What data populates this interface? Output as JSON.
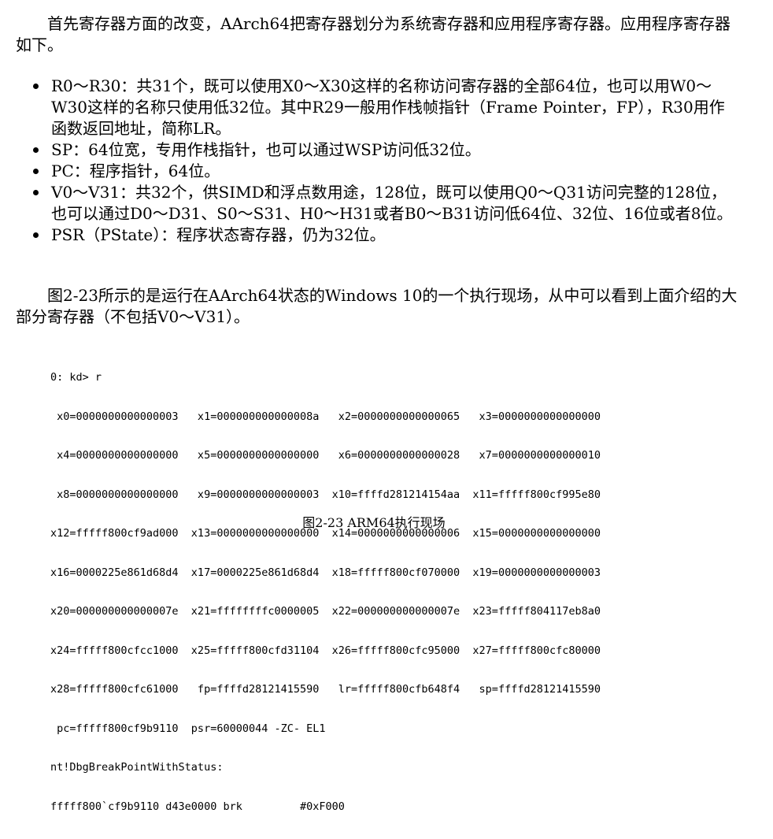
{
  "paragraphs": {
    "intro": "首先寄存器方面的改变，AArch64把寄存器划分为系统寄存器和应用程序寄存器。应用程序寄存器如下。",
    "figure_intro": "图2-23所示的是运行在AArch64状态的Windows 10的一个执行现场，从中可以看到上面介绍的大部分寄存器（不包括V0～V31）。"
  },
  "bullets": [
    "R0～R30：共31个，既可以使用X0～X30这样的名称访问寄存器的全部64位，也可以用W0～W30这样的名称只使用低32位。其中R29一般用作栈帧指针（Frame Pointer，FP），R30用作函数返回地址，简称LR。",
    "SP：64位宽，专用作栈指针，也可以通过WSP访问低32位。",
    "PC：程序指针，64位。",
    "V0～V31：共32个，供SIMD和浮点数用途，128位，既可以使用Q0～Q31访问完整的128位，也可以通过D0～D31、S0～S31、H0～H31或者B0～B31访问低64位、32位、16位或者8位。",
    "PSR（PState）：程序状态寄存器，仍为32位。"
  ],
  "code_lines": [
    "0: kd> r",
    " x0=0000000000000003   x1=000000000000008a   x2=0000000000000065   x3=0000000000000000",
    " x4=0000000000000000   x5=0000000000000000   x6=0000000000000028   x7=0000000000000010",
    " x8=0000000000000000   x9=0000000000000003  x10=ffffd281214154aa  x11=fffff800cf995e80",
    "x12=fffff800cf9ad000  x13=0000000000000000  x14=0000000000000006  x15=0000000000000000",
    "x16=0000225e861d68d4  x17=0000225e861d68d4  x18=fffff800cf070000  x19=0000000000000003",
    "x20=000000000000007e  x21=ffffffffc0000005  x22=000000000000007e  x23=fffff804117eb8a0",
    "x24=fffff800cfcc1000  x25=fffff800cfd31104  x26=fffff800cfc95000  x27=fffff800cfc80000",
    "x28=fffff800cfc61000   fp=ffffd28121415590   lr=fffff800cfb648f4   sp=ffffd28121415590",
    " pc=fffff800cf9b9110  psr=60000044 -ZC- EL1",
    "nt!DbgBreakPointWithStatus:",
    "fffff800`cf9b9110 d43e0000 brk         #0xF000"
  ],
  "caption": "图2-23    ARM64执行现场"
}
